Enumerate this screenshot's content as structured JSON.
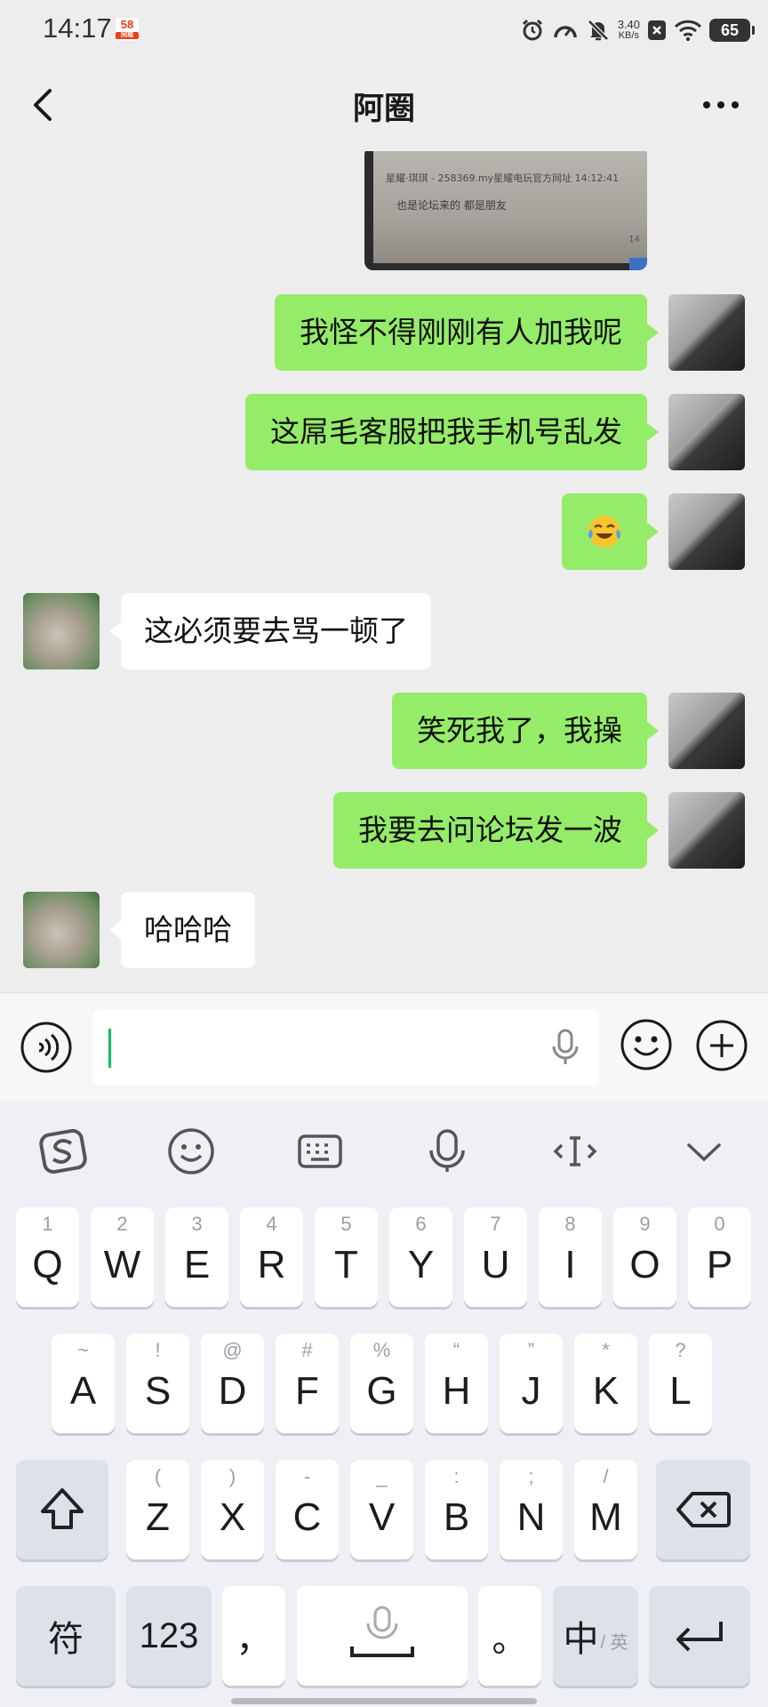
{
  "status_bar": {
    "time": "14:17",
    "app_badge": "58",
    "app_badge_sub": "同城",
    "net_speed_value": "3.40",
    "net_speed_unit": "KB/s",
    "battery": "65"
  },
  "header": {
    "title": "阿圈"
  },
  "photo_message": {
    "line1": "星耀·琪琪 - 258369.my星耀电玩官方网址 14:12:41",
    "line2": "也是论坛来的 都是朋友",
    "corner": "14"
  },
  "messages": [
    {
      "from": "me",
      "text": "我怪不得刚刚有人加我呢"
    },
    {
      "from": "me",
      "text": "这屌毛客服把我手机号乱发"
    },
    {
      "from": "me",
      "text": "",
      "emoji": "tears-of-joy-emoji"
    },
    {
      "from": "other",
      "text": "这必须要去骂一顿了"
    },
    {
      "from": "me",
      "text": "笑死我了，我操"
    },
    {
      "from": "me",
      "text": "我要去问论坛发一波"
    },
    {
      "from": "other",
      "text": "哈哈哈"
    }
  ],
  "input": {
    "value": ""
  },
  "keyboard": {
    "row1": [
      {
        "sub": "1",
        "main": "Q"
      },
      {
        "sub": "2",
        "main": "W"
      },
      {
        "sub": "3",
        "main": "E"
      },
      {
        "sub": "4",
        "main": "R"
      },
      {
        "sub": "5",
        "main": "T"
      },
      {
        "sub": "6",
        "main": "Y"
      },
      {
        "sub": "7",
        "main": "U"
      },
      {
        "sub": "8",
        "main": "I"
      },
      {
        "sub": "9",
        "main": "O"
      },
      {
        "sub": "0",
        "main": "P"
      }
    ],
    "row2": [
      {
        "sub": "~",
        "main": "A"
      },
      {
        "sub": "!",
        "main": "S"
      },
      {
        "sub": "@",
        "main": "D"
      },
      {
        "sub": "#",
        "main": "F"
      },
      {
        "sub": "%",
        "main": "G"
      },
      {
        "sub": "“",
        "main": "H"
      },
      {
        "sub": "”",
        "main": "J"
      },
      {
        "sub": "*",
        "main": "K"
      },
      {
        "sub": "?",
        "main": "L"
      }
    ],
    "row3": [
      {
        "sub": "(",
        "main": "Z"
      },
      {
        "sub": ")",
        "main": "X"
      },
      {
        "sub": "-",
        "main": "C"
      },
      {
        "sub": "_",
        "main": "V"
      },
      {
        "sub": ":",
        "main": "B"
      },
      {
        "sub": ";",
        "main": "N"
      },
      {
        "sub": "/",
        "main": "M"
      }
    ],
    "symbol_key": "符",
    "number_key": "123",
    "comma_key": "，",
    "period_key": "。",
    "lang_key_main": "中",
    "lang_key_sub": "/ 英"
  }
}
